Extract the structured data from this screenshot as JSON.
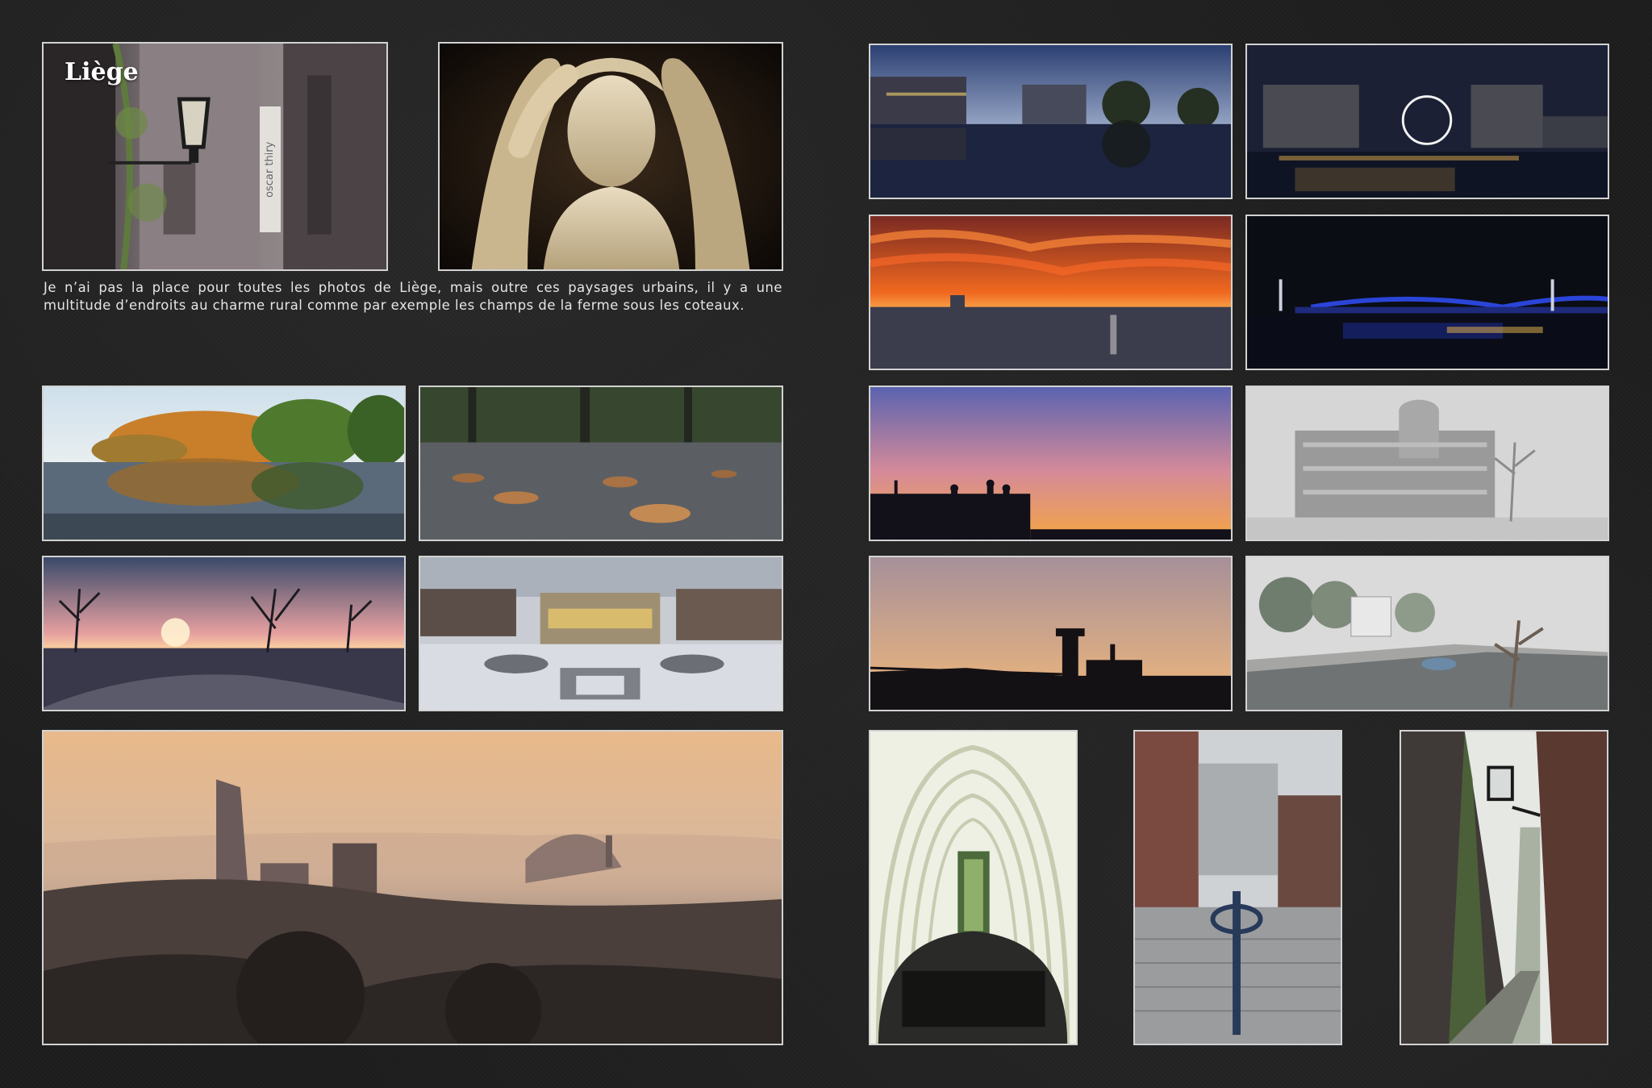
{
  "page": {
    "title": "Liège"
  },
  "caption": "Je n’ai pas la place pour toutes les photos de Liège, mais outre ces paysages urbains, il y a une multitude d’endroits au charme rural comme par exemple les champs de la ferme sous les coteaux.",
  "photo_1": {
    "sign_text": "oscar thiry"
  }
}
